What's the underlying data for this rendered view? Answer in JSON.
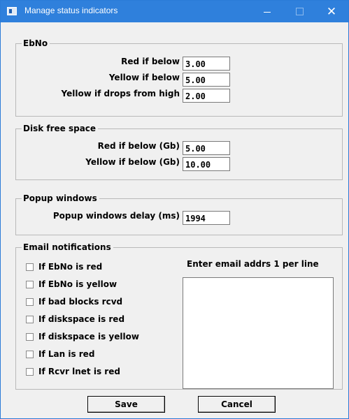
{
  "window": {
    "title": "Manage status indicators",
    "close_glyph": "✕",
    "icon": "app-window-icon"
  },
  "ebno": {
    "legend": "EbNo",
    "fields": [
      {
        "label": "Red if below",
        "value": "3.00"
      },
      {
        "label": "Yellow if below",
        "value": "5.00"
      },
      {
        "label": "Yellow if drops from high",
        "value": "2.00"
      }
    ]
  },
  "disk": {
    "legend": "Disk free space",
    "fields": [
      {
        "label": "Red if below (Gb)",
        "value": "5.00"
      },
      {
        "label": "Yellow if below (Gb)",
        "value": "10.00"
      }
    ]
  },
  "popup": {
    "legend": "Popup windows",
    "fields": [
      {
        "label": "Popup windows delay (ms)",
        "value": "1994"
      }
    ]
  },
  "email": {
    "legend": "Email notifications",
    "caption": "Enter email addrs 1 per line",
    "address_text": "",
    "checks": [
      {
        "label": "If EbNo is red",
        "checked": false
      },
      {
        "label": "If EbNo is yellow",
        "checked": false
      },
      {
        "label": "If bad blocks rcvd",
        "checked": false
      },
      {
        "label": "If diskspace is red",
        "checked": false
      },
      {
        "label": "If diskspace is yellow",
        "checked": false
      },
      {
        "label": "If Lan is red",
        "checked": false
      },
      {
        "label": "If Rcvr lnet is red",
        "checked": false
      }
    ]
  },
  "buttons": {
    "save": "Save",
    "cancel": "Cancel"
  },
  "colors": {
    "titlebar": "#2f80dc",
    "dialog_bg": "#f0f0f0"
  }
}
